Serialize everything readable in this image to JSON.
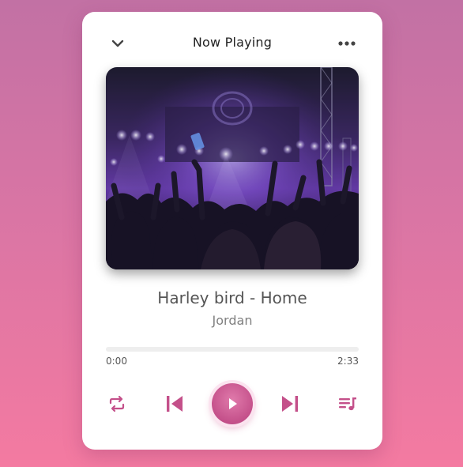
{
  "header": {
    "title": "Now Playing",
    "collapse_icon": "chevron-down-icon",
    "more_icon": "more-horizontal-icon"
  },
  "track": {
    "title": "Harley bird - Home",
    "artist": "Jordan",
    "artwork": "concert-crowd-image"
  },
  "progress": {
    "current": "0:00",
    "duration": "2:33",
    "fraction": 0
  },
  "controls": {
    "repeat_icon": "repeat-icon",
    "previous_icon": "skip-back-icon",
    "play_icon": "play-icon",
    "next_icon": "skip-forward-icon",
    "playlist_icon": "playlist-icon"
  },
  "colors": {
    "accent": "#c4508a",
    "background_top": "#c271a4",
    "background_bottom": "#f47aa1"
  }
}
